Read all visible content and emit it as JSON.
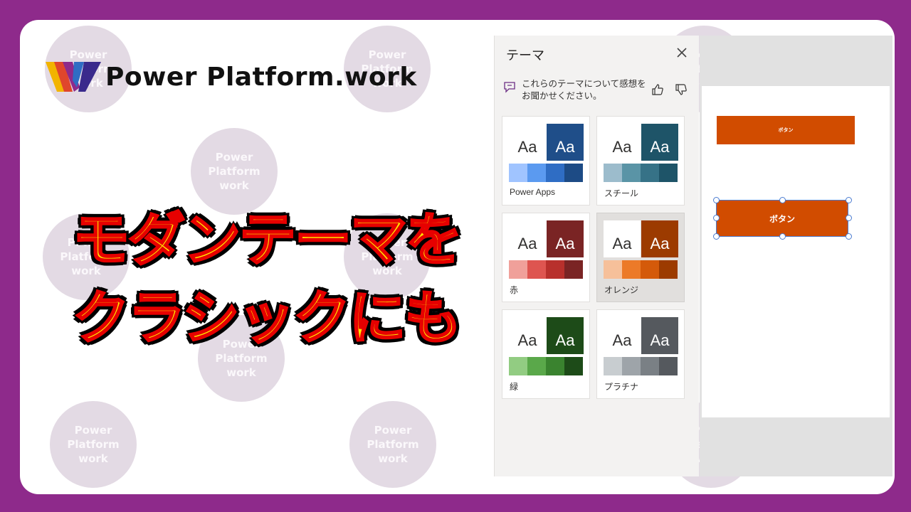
{
  "watermark": {
    "text": "Power Platform work"
  },
  "logo": {
    "text": "Power Platform.work"
  },
  "headline": {
    "line1": "モダンテーマを",
    "line2": "クラシックにも"
  },
  "pane": {
    "title": "テーマ",
    "close_icon": "close-icon",
    "feedback_text": "これらのテーマについて感想をお聞かせください。"
  },
  "themes": [
    {
      "label": "Power Apps",
      "aa": "Aa",
      "dark": "#1f4e89",
      "swatches": [
        "#a0c4ff",
        "#5b9af0",
        "#2f6dc4",
        "#1d4b85"
      ]
    },
    {
      "label": "スチール",
      "aa": "Aa",
      "dark": "#1e5468",
      "swatches": [
        "#9cbccc",
        "#5a94a6",
        "#367287",
        "#1e5468"
      ]
    },
    {
      "label": "赤",
      "aa": "Aa",
      "dark": "#7a2424",
      "swatches": [
        "#f0a09a",
        "#de5550",
        "#b8302c",
        "#7a2424"
      ]
    },
    {
      "label": "オレンジ",
      "aa": "Aa",
      "dark": "#9c3b00",
      "swatches": [
        "#f6c09a",
        "#ec7a28",
        "#d45a0a",
        "#9c3b00"
      ]
    },
    {
      "label": "緑",
      "aa": "Aa",
      "dark": "#1d4b18",
      "swatches": [
        "#92cc82",
        "#5aa84a",
        "#3a832f",
        "#1d4b18"
      ]
    },
    {
      "label": "プラチナ",
      "aa": "Aa",
      "dark": "#55595e",
      "swatches": [
        "#c8cdd0",
        "#9ea4a9",
        "#7a8085",
        "#55595e"
      ]
    }
  ],
  "selected_theme": "オレンジ",
  "canvas": {
    "button_small": "ボタン",
    "button_selected": "ボタン",
    "button_color": "#d14c00"
  }
}
